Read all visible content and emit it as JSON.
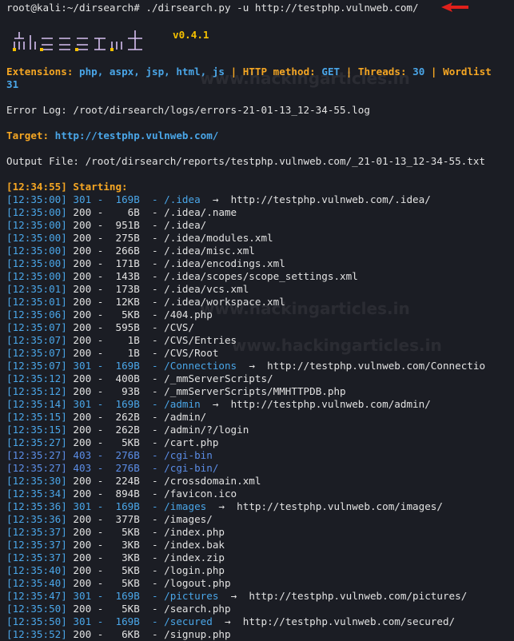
{
  "prompt": {
    "user": "root@kali:~/dirsearch#",
    "command": " ./dirsearch.py -u http://testphp.vulnweb.com/"
  },
  "logo": {
    "version": "v0.4.1"
  },
  "watermark": "www.hackingarticles.in",
  "config": {
    "ext_label": "Extensions:",
    "ext_value": "php, aspx, jsp, html, js",
    "sep1": "|",
    "method_label": "HTTP method:",
    "method_value": "GET",
    "sep2": "|",
    "threads_label": "Threads:",
    "threads_value": "30",
    "sep3": "|",
    "wordlist_label": "Wordlist",
    "wrap_value": "31"
  },
  "error_log": "Error Log: /root/dirsearch/logs/errors-21-01-13_12-34-55.log",
  "target_label": "Target:",
  "target_value": "http://testphp.vulnweb.com/",
  "output_file": "Output File: /root/dirsearch/reports/testphp.vulnweb.com/_21-01-13_12-34-55.txt",
  "starting": "[12:34:55] Starting:",
  "results": [
    {
      "ts": "[12:35:00]",
      "code": "301",
      "size": "169B",
      "path": "/.idea",
      "redirect": "http://testphp.vulnweb.com/.idea/",
      "kind": "cyan"
    },
    {
      "ts": "[12:35:00]",
      "code": "200",
      "size": "6B",
      "path": "/.idea/.name",
      "redirect": "",
      "kind": "green"
    },
    {
      "ts": "[12:35:00]",
      "code": "200",
      "size": "951B",
      "path": "/.idea/",
      "redirect": "",
      "kind": "green"
    },
    {
      "ts": "[12:35:00]",
      "code": "200",
      "size": "275B",
      "path": "/.idea/modules.xml",
      "redirect": "",
      "kind": "green"
    },
    {
      "ts": "[12:35:00]",
      "code": "200",
      "size": "266B",
      "path": "/.idea/misc.xml",
      "redirect": "",
      "kind": "green"
    },
    {
      "ts": "[12:35:00]",
      "code": "200",
      "size": "171B",
      "path": "/.idea/encodings.xml",
      "redirect": "",
      "kind": "green"
    },
    {
      "ts": "[12:35:00]",
      "code": "200",
      "size": "143B",
      "path": "/.idea/scopes/scope_settings.xml",
      "redirect": "",
      "kind": "green"
    },
    {
      "ts": "[12:35:01]",
      "code": "200",
      "size": "173B",
      "path": "/.idea/vcs.xml",
      "redirect": "",
      "kind": "green"
    },
    {
      "ts": "[12:35:01]",
      "code": "200",
      "size": "12KB",
      "path": "/.idea/workspace.xml",
      "redirect": "",
      "kind": "green"
    },
    {
      "ts": "[12:35:06]",
      "code": "200",
      "size": "5KB",
      "path": "/404.php",
      "redirect": "",
      "kind": "green"
    },
    {
      "ts": "[12:35:07]",
      "code": "200",
      "size": "595B",
      "path": "/CVS/",
      "redirect": "",
      "kind": "green"
    },
    {
      "ts": "[12:35:07]",
      "code": "200",
      "size": "1B",
      "path": "/CVS/Entries",
      "redirect": "",
      "kind": "green"
    },
    {
      "ts": "[12:35:07]",
      "code": "200",
      "size": "1B",
      "path": "/CVS/Root",
      "redirect": "",
      "kind": "green"
    },
    {
      "ts": "[12:35:07]",
      "code": "301",
      "size": "169B",
      "path": "/Connections",
      "redirect": "http://testphp.vulnweb.com/Connectio",
      "kind": "cyan"
    },
    {
      "ts": "[12:35:12]",
      "code": "200",
      "size": "400B",
      "path": "/_mmServerScripts/",
      "redirect": "",
      "kind": "green"
    },
    {
      "ts": "[12:35:12]",
      "code": "200",
      "size": "93B",
      "path": "/_mmServerScripts/MMHTTPDB.php",
      "redirect": "",
      "kind": "green"
    },
    {
      "ts": "[12:35:14]",
      "code": "301",
      "size": "169B",
      "path": "/admin",
      "redirect": "http://testphp.vulnweb.com/admin/",
      "kind": "cyan"
    },
    {
      "ts": "[12:35:15]",
      "code": "200",
      "size": "262B",
      "path": "/admin/",
      "redirect": "",
      "kind": "green"
    },
    {
      "ts": "[12:35:15]",
      "code": "200",
      "size": "262B",
      "path": "/admin/?/login",
      "redirect": "",
      "kind": "green"
    },
    {
      "ts": "[12:35:27]",
      "code": "200",
      "size": "5KB",
      "path": "/cart.php",
      "redirect": "",
      "kind": "green"
    },
    {
      "ts": "[12:35:27]",
      "code": "403",
      "size": "276B",
      "path": "/cgi-bin",
      "redirect": "",
      "kind": "blue"
    },
    {
      "ts": "[12:35:27]",
      "code": "403",
      "size": "276B",
      "path": "/cgi-bin/",
      "redirect": "",
      "kind": "blue"
    },
    {
      "ts": "[12:35:30]",
      "code": "200",
      "size": "224B",
      "path": "/crossdomain.xml",
      "redirect": "",
      "kind": "green"
    },
    {
      "ts": "[12:35:34]",
      "code": "200",
      "size": "894B",
      "path": "/favicon.ico",
      "redirect": "",
      "kind": "green"
    },
    {
      "ts": "[12:35:36]",
      "code": "301",
      "size": "169B",
      "path": "/images",
      "redirect": "http://testphp.vulnweb.com/images/",
      "kind": "cyan"
    },
    {
      "ts": "[12:35:36]",
      "code": "200",
      "size": "377B",
      "path": "/images/",
      "redirect": "",
      "kind": "green"
    },
    {
      "ts": "[12:35:37]",
      "code": "200",
      "size": "5KB",
      "path": "/index.php",
      "redirect": "",
      "kind": "green"
    },
    {
      "ts": "[12:35:37]",
      "code": "200",
      "size": "3KB",
      "path": "/index.bak",
      "redirect": "",
      "kind": "green"
    },
    {
      "ts": "[12:35:37]",
      "code": "200",
      "size": "3KB",
      "path": "/index.zip",
      "redirect": "",
      "kind": "green"
    },
    {
      "ts": "[12:35:40]",
      "code": "200",
      "size": "5KB",
      "path": "/login.php",
      "redirect": "",
      "kind": "green"
    },
    {
      "ts": "[12:35:40]",
      "code": "200",
      "size": "5KB",
      "path": "/logout.php",
      "redirect": "",
      "kind": "green"
    },
    {
      "ts": "[12:35:47]",
      "code": "301",
      "size": "169B",
      "path": "/pictures",
      "redirect": "http://testphp.vulnweb.com/pictures/",
      "kind": "cyan"
    },
    {
      "ts": "[12:35:50]",
      "code": "200",
      "size": "5KB",
      "path": "/search.php",
      "redirect": "",
      "kind": "green"
    },
    {
      "ts": "[12:35:50]",
      "code": "301",
      "size": "169B",
      "path": "/secured",
      "redirect": "http://testphp.vulnweb.com/secured/",
      "kind": "cyan"
    },
    {
      "ts": "[12:35:52]",
      "code": "200",
      "size": "6KB",
      "path": "/signup.php",
      "redirect": "",
      "kind": "green"
    }
  ],
  "colors": {
    "background": "#1b1d24",
    "orange": "#f5a623",
    "blue": "#4aa6e8",
    "green": "#78c052",
    "forbidden": "#5b8de6",
    "arrow_red": "#e0201b"
  },
  "icons": {
    "annotation": "red-arrow-icon",
    "logo": "dirsearch-ascii-logo"
  }
}
